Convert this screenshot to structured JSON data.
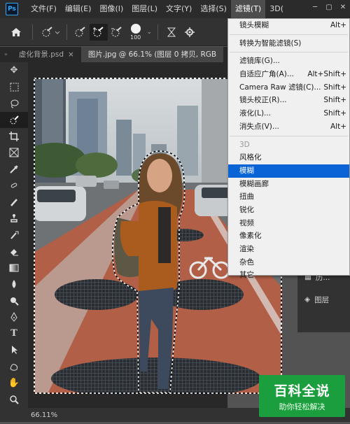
{
  "app": {
    "logo": "Ps"
  },
  "menubar": {
    "items": [
      "文件(F)",
      "编辑(E)",
      "图像(I)",
      "图层(L)",
      "文字(Y)",
      "选择(S)",
      "滤镜(T)",
      "3D("
    ],
    "active_index": 6
  },
  "options_bar": {
    "brush_size": "100"
  },
  "tabs": [
    {
      "label": "虚化背景.psd",
      "close": "×"
    },
    {
      "label": "图片.jpg @ 66.1% (图层 0 拷贝, RGB",
      "close": ""
    }
  ],
  "tools": [
    "move-tool",
    "marquee-tool",
    "lasso-tool",
    "quick-selection-tool",
    "crop-tool",
    "frame-tool",
    "eyedropper-tool",
    "healing-brush-tool",
    "brush-tool",
    "clone-stamp-tool",
    "history-brush-tool",
    "eraser-tool",
    "gradient-tool",
    "blur-tool",
    "dodge-tool",
    "pen-tool",
    "type-tool",
    "path-selection-tool",
    "shape-tool",
    "hand-tool",
    "zoom-tool",
    "more-tools"
  ],
  "status": {
    "zoom": "66.11%"
  },
  "filter_menu": {
    "items": [
      {
        "label": "镜头模糊",
        "shortcut": "Alt+",
        "disabled": false,
        "selected": false,
        "sep_after": true
      },
      {
        "label": "转换为智能滤镜(S)",
        "shortcut": "",
        "disabled": false,
        "selected": false,
        "sep_after": true
      },
      {
        "label": "滤镜库(G)...",
        "shortcut": "",
        "disabled": false,
        "selected": false,
        "sep_after": false
      },
      {
        "label": "自适应广角(A)...",
        "shortcut": "Alt+Shift+",
        "disabled": false,
        "selected": false,
        "sep_after": false
      },
      {
        "label": "Camera Raw 滤镜(C)...",
        "shortcut": "Shift+",
        "disabled": false,
        "selected": false,
        "sep_after": false
      },
      {
        "label": "镜头校正(R)...",
        "shortcut": "Shift+",
        "disabled": false,
        "selected": false,
        "sep_after": false
      },
      {
        "label": "液化(L)...",
        "shortcut": "Shift+",
        "disabled": false,
        "selected": false,
        "sep_after": false
      },
      {
        "label": "消失点(V)...",
        "shortcut": "Alt+",
        "disabled": false,
        "selected": false,
        "sep_after": true
      },
      {
        "label": "3D",
        "shortcut": "",
        "disabled": true,
        "selected": false,
        "sep_after": false
      },
      {
        "label": "风格化",
        "shortcut": "",
        "disabled": false,
        "selected": false,
        "sep_after": false
      },
      {
        "label": "模糊",
        "shortcut": "",
        "disabled": false,
        "selected": true,
        "sep_after": false
      },
      {
        "label": "模糊画廊",
        "shortcut": "",
        "disabled": false,
        "selected": false,
        "sep_after": false
      },
      {
        "label": "扭曲",
        "shortcut": "",
        "disabled": false,
        "selected": false,
        "sep_after": false
      },
      {
        "label": "锐化",
        "shortcut": "",
        "disabled": false,
        "selected": false,
        "sep_after": false
      },
      {
        "label": "视频",
        "shortcut": "",
        "disabled": false,
        "selected": false,
        "sep_after": false
      },
      {
        "label": "像素化",
        "shortcut": "",
        "disabled": false,
        "selected": false,
        "sep_after": false
      },
      {
        "label": "渲染",
        "shortcut": "",
        "disabled": false,
        "selected": false,
        "sep_after": false
      },
      {
        "label": "杂色",
        "shortcut": "",
        "disabled": false,
        "selected": false,
        "sep_after": false
      },
      {
        "label": "其它",
        "shortcut": "",
        "disabled": false,
        "selected": false,
        "sep_after": false
      }
    ]
  },
  "right_panel": {
    "items": [
      {
        "label": "历..."
      },
      {
        "label": "图层"
      }
    ]
  },
  "watermark": {
    "title": "百科全说",
    "subtitle": "助你轻松解决"
  }
}
